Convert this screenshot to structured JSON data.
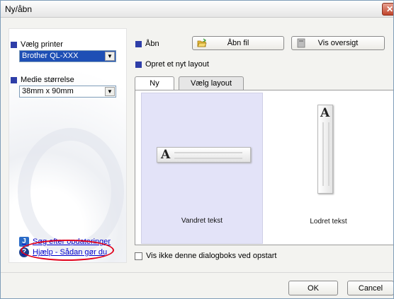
{
  "window": {
    "title": "Ny/åbn",
    "close_glyph": "✕"
  },
  "printer": {
    "label": "Vælg printer",
    "value": "Brother QL-XXX"
  },
  "media": {
    "label": "Medie størrelse",
    "value": "38mm x 90mm"
  },
  "links": {
    "updates": "Søg efter opdateringer",
    "help": "Hjælp - Sådan gør du"
  },
  "open": {
    "label": "Åbn",
    "open_file": "Åbn fil",
    "view_overview": "Vis oversigt"
  },
  "new_layout": {
    "label": "Opret et nyt layout"
  },
  "tabs": [
    {
      "label": "Ny",
      "active": true
    },
    {
      "label": "Vælg layout",
      "active": false
    }
  ],
  "cards": {
    "horizontal": {
      "label": "Vandret tekst",
      "glyph": "A"
    },
    "vertical": {
      "label": "Lodret tekst",
      "glyph": "A"
    }
  },
  "startup": {
    "label": "Vis ikke denne dialogboks ved opstart",
    "checked": false
  },
  "footer": {
    "ok": "OK",
    "cancel": "Cancel"
  },
  "icons": {
    "updates": "update-icon",
    "help": "help-icon",
    "folder": "folder-open-icon",
    "overview": "document-icon"
  },
  "colors": {
    "accent": "#2e3ea8",
    "selected": "#1e4fb5",
    "highlight": "#e0001a",
    "card": "#e3e3f8"
  }
}
